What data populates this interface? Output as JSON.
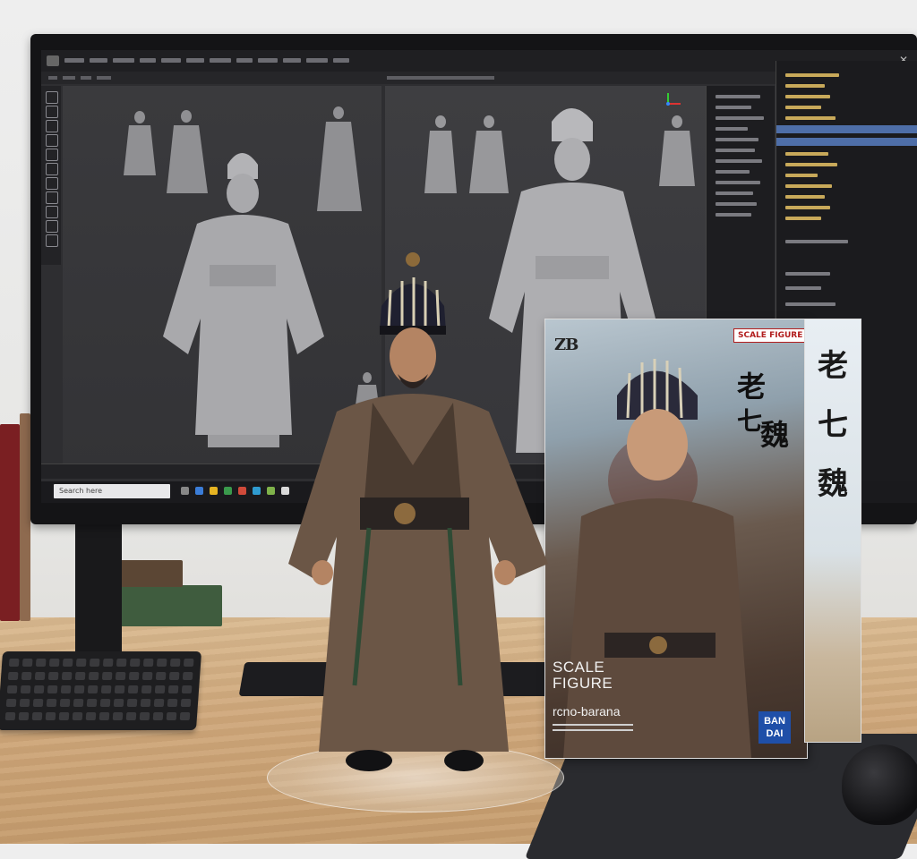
{
  "scene": {
    "description_hidden": false
  },
  "software": {
    "viewport_left_label": "",
    "viewport_right_label": "",
    "taskbar_search": "Search here",
    "window_close": "✕"
  },
  "box": {
    "brand_logo": "ZB",
    "badge": "SCALE FIGURE",
    "title_line1": "SCALE",
    "title_line2": "FIGURE",
    "subtitle": "rcno-barana",
    "publisher": "BAN DAI",
    "publisher_line1": "BAN",
    "publisher_line2": "DAI"
  },
  "colors": {
    "badge_red": "#b21e1e",
    "publisher_blue": "#1f4fa8",
    "selection_blue": "#4e6ea8",
    "robe_brown": "#6b5646"
  }
}
